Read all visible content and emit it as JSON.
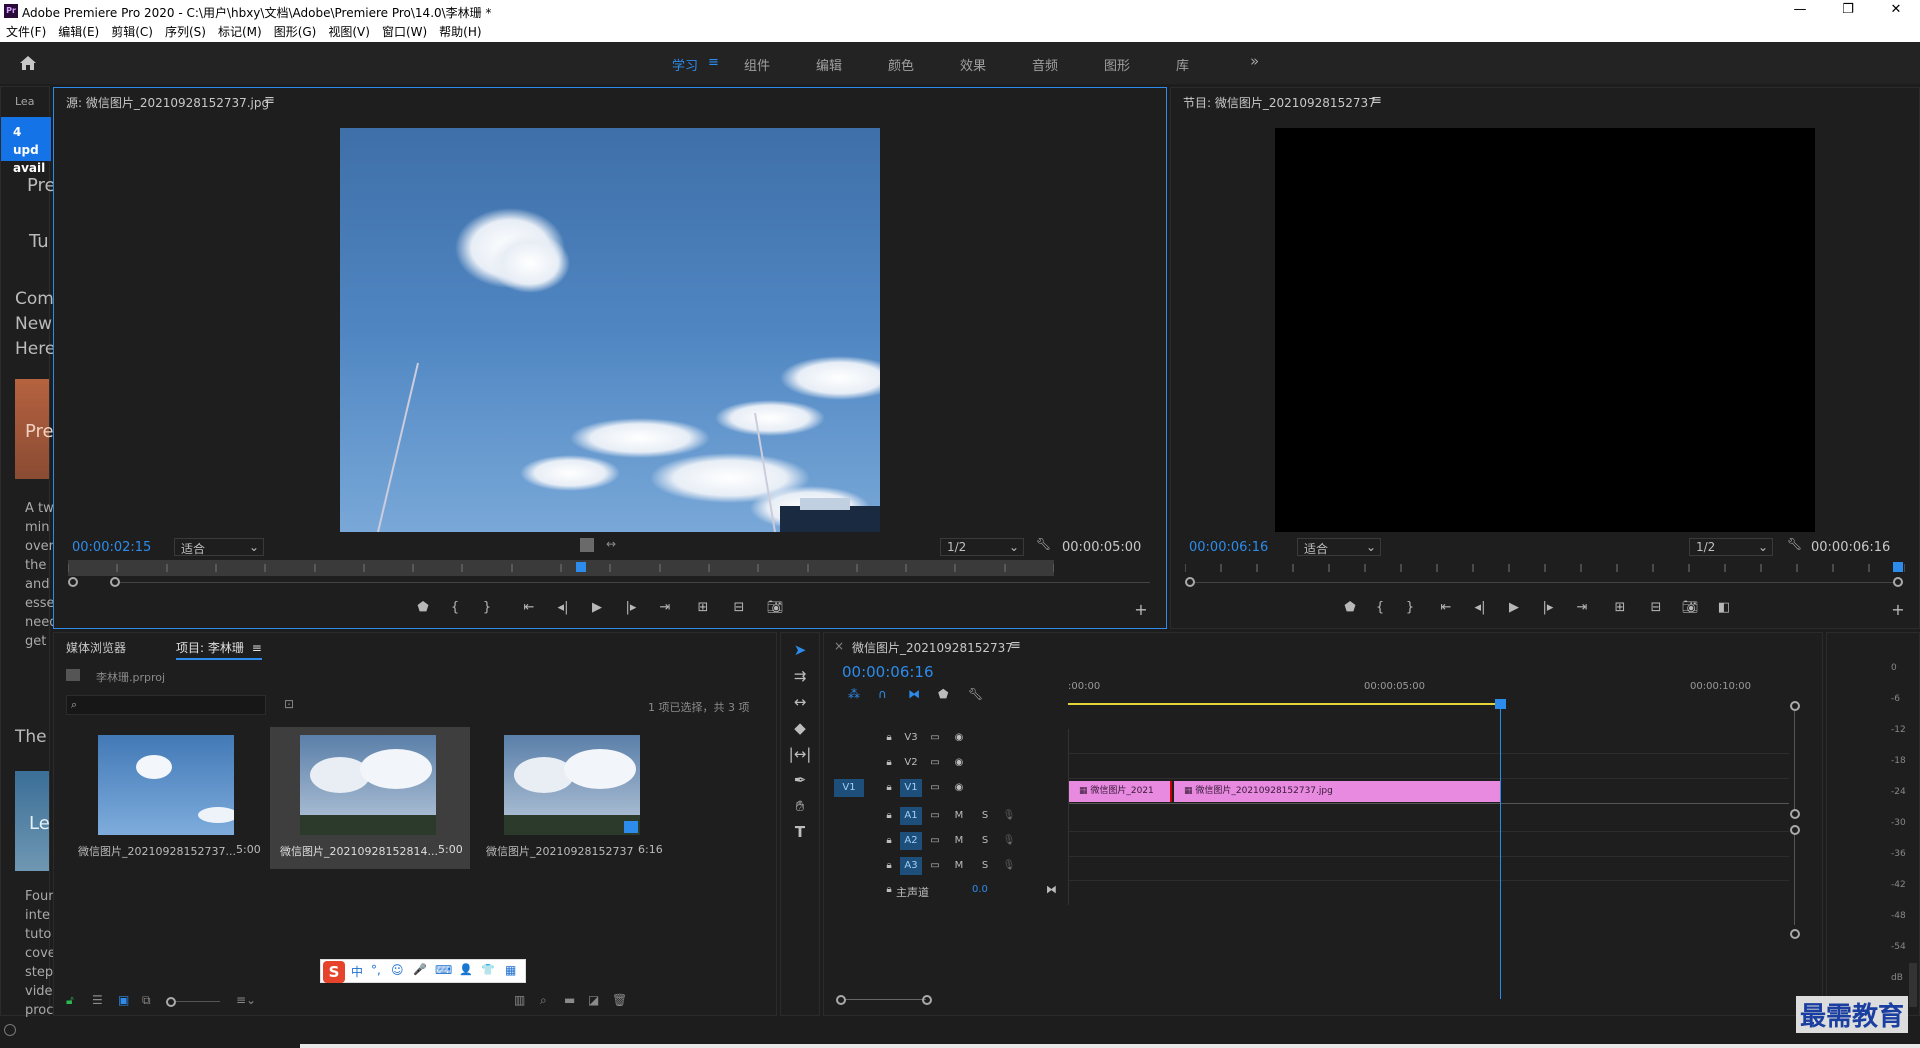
{
  "window": {
    "title": "Adobe Premiere Pro 2020 - C:\\用户\\hbxy\\文档\\Adobe\\Premiere Pro\\14.0\\李林珊 *",
    "app_icon": "Pr",
    "min": "—",
    "restore": "❐",
    "close": "✕"
  },
  "menu": [
    "文件(F)",
    "编辑(E)",
    "剪辑(C)",
    "序列(S)",
    "标记(M)",
    "图形(G)",
    "视图(V)",
    "窗口(W)",
    "帮助(H)"
  ],
  "workspaces": [
    "学习",
    "组件",
    "编辑",
    "颜色",
    "效果",
    "音频",
    "图形",
    "库"
  ],
  "workspace_active": "学习",
  "workspace_more": "»",
  "learn_panel": {
    "tab": "Lea",
    "banner": [
      "4 upd",
      "avail"
    ],
    "lines": [
      "Pre",
      "Tu",
      "Com",
      "New",
      "Here",
      "Pre",
      "A tw",
      "min",
      "over",
      "the",
      "and",
      "esse",
      "need",
      "get",
      "The",
      "Le",
      "Four",
      "inte",
      "tuto",
      "cove",
      "step",
      "vide",
      "proc"
    ]
  },
  "source": {
    "title": "源: 微信图片_20210928152737.jpg",
    "timecode": "00:00:02:15",
    "fit": "适合",
    "res": "1/2",
    "duration": "00:00:05:00",
    "playhead": 0.52
  },
  "program": {
    "title": "节目: 微信图片_20210928152737",
    "timecode": "00:00:06:16",
    "fit": "适合",
    "res": "1/2",
    "duration": "00:00:06:16",
    "playhead": 0.99
  },
  "project": {
    "tabs": [
      "媒体浏览器",
      "项目: 李林珊"
    ],
    "file": "李林珊.prproj",
    "status": "1 项已选择，共 3 项",
    "items": [
      {
        "name": "微信图片_20210928152737...",
        "dur": "5:00"
      },
      {
        "name": "微信图片_20210928152814...",
        "dur": "5:00"
      },
      {
        "name": "微信图片_20210928152737",
        "dur": "6:16"
      }
    ]
  },
  "ime": {
    "logo": "S",
    "items": [
      "中",
      "°,",
      "☺",
      "🎤",
      "⌨",
      "👤",
      "👕",
      "▦"
    ]
  },
  "timeline": {
    "title": "微信图片_20210928152737",
    "timecode": "00:00:06:16",
    "ruler": [
      ":00:00",
      "00:00:05:00",
      "00:00:10:00"
    ],
    "video_tracks": [
      "V3",
      "V2",
      "V1"
    ],
    "source_patch": "V1",
    "audio_tracks": [
      "A1",
      "A2",
      "A3"
    ],
    "master": "主声道",
    "master_val": "0.0",
    "m": "M",
    "s": "S",
    "clips": [
      {
        "label": "微信图片_2021",
        "start": 0,
        "end": 1.6
      },
      {
        "label": "微信图片_20210928152737.jpg",
        "start": 1.6,
        "end": 6.6
      }
    ],
    "playhead_sec": 6.6
  },
  "meter": {
    "labels": [
      "0",
      "-6",
      "-12",
      "-18",
      "-24",
      "-30",
      "-36",
      "-42",
      "-48",
      "-54",
      "dB"
    ]
  },
  "watermark": "最需教育",
  "colors": {
    "accent": "#2d8ceb",
    "clip": "#e78ae0",
    "active_ws": "#2d8ceb"
  }
}
